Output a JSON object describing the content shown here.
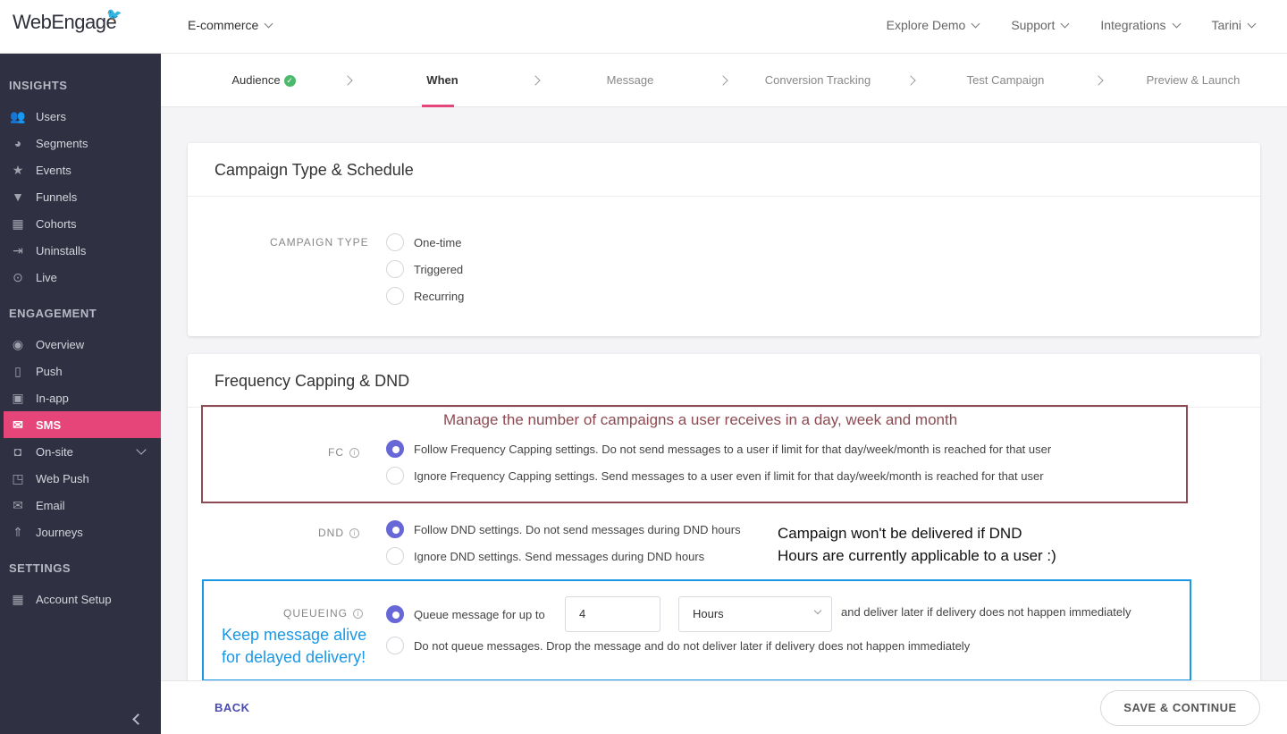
{
  "brand": {
    "logo_text": "WebEngage"
  },
  "project": {
    "name": "E-commerce"
  },
  "topnav": [
    "Explore Demo",
    "Support",
    "Integrations",
    "Tarini"
  ],
  "sidebar": {
    "insights_title": "INSIGHTS",
    "insights": [
      {
        "label": "Users",
        "icon": "users-icon"
      },
      {
        "label": "Segments",
        "icon": "pie-icon"
      },
      {
        "label": "Events",
        "icon": "star-icon"
      },
      {
        "label": "Funnels",
        "icon": "funnel-icon"
      },
      {
        "label": "Cohorts",
        "icon": "grid-icon"
      },
      {
        "label": "Uninstalls",
        "icon": "exit-icon"
      },
      {
        "label": "Live",
        "icon": "broadcast-icon"
      }
    ],
    "engagement_title": "ENGAGEMENT",
    "engagement": [
      {
        "label": "Overview",
        "icon": "eye-icon"
      },
      {
        "label": "Push",
        "icon": "mobile-icon"
      },
      {
        "label": "In-app",
        "icon": "mobile-app-icon"
      },
      {
        "label": "SMS",
        "icon": "sms-icon"
      },
      {
        "label": "On-site",
        "icon": "window-icon"
      },
      {
        "label": "Web Push",
        "icon": "browser-icon"
      },
      {
        "label": "Email",
        "icon": "mail-icon"
      },
      {
        "label": "Journeys",
        "icon": "rocket-icon"
      }
    ],
    "settings_title": "SETTINGS",
    "settings": [
      {
        "label": "Account Setup",
        "icon": "apps-icon"
      }
    ],
    "active": "SMS"
  },
  "steps": [
    "Audience",
    "When",
    "Message",
    "Conversion Tracking",
    "Test Campaign",
    "Preview & Launch"
  ],
  "campaign_type": {
    "title": "Campaign Type & Schedule",
    "label": "CAMPAIGN TYPE",
    "options": [
      "One-time",
      "Triggered",
      "Recurring"
    ]
  },
  "frequency": {
    "title": "Frequency Capping & DND",
    "fc_label": "FC",
    "fc_options": [
      "Follow Frequency Capping settings. Do not send messages to a user if limit for that day/week/month is reached for that user",
      "Ignore Frequency Capping settings. Send messages to a user even if limit for that day/week/month is reached for that user"
    ],
    "dnd_label": "DND",
    "dnd_options": [
      "Follow DND settings. Do not send messages during DND hours",
      "Ignore DND settings. Send messages during DND hours"
    ],
    "queue_label": "QUEUEING",
    "queue_prefix": "Queue message for up to",
    "queue_value": "4",
    "queue_unit": "Hours",
    "queue_suffix": "and deliver later if delivery does not happen immediately",
    "no_queue": "Do not queue messages. Drop the message and do not deliver later if delivery does not happen immediately"
  },
  "annotations": {
    "fc": "Manage the number of campaigns a user receives in a day, week and month",
    "dnd_line1": "Campaign won't be delivered if DND",
    "dnd_line2": "Hours are currently applicable to a user :)",
    "queue_line1": "Keep message alive",
    "queue_line2": "for delayed delivery!"
  },
  "footer": {
    "back": "BACK",
    "save": "SAVE & CONTINUE"
  },
  "colors": {
    "accent": "#e6457a",
    "radio": "#6867d8",
    "sidebar": "#2f3142",
    "annot_red": "#8c4b52",
    "annot_blue": "#1a98e6"
  }
}
